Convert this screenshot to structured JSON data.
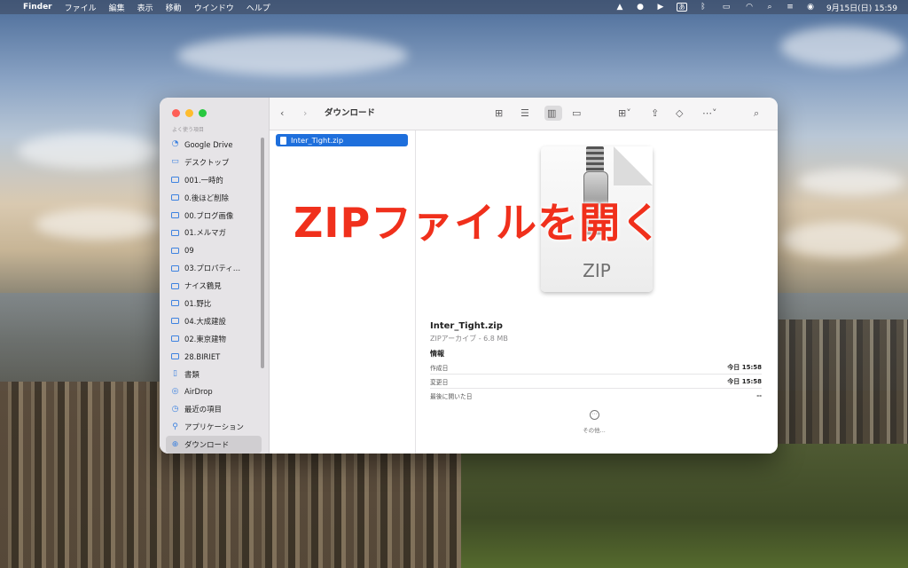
{
  "menubar": {
    "apple": "",
    "app_name": "Finder",
    "menus": [
      "ファイル",
      "編集",
      "表示",
      "移動",
      "ウインドウ",
      "ヘルプ"
    ],
    "input_method": "あ",
    "datetime": "9月15日(日)  15:59",
    "icons": [
      "drive-icon",
      "line-icon",
      "play-icon",
      "input-method-icon",
      "bluetooth-icon",
      "battery-icon",
      "wifi-icon",
      "search-icon",
      "control-center-icon",
      "siri-icon"
    ]
  },
  "finder": {
    "window_title": "ダウンロード",
    "sidebar_section": "よく使う項目",
    "sidebar_items": [
      {
        "label": "Google Drive",
        "icon": "google-drive-icon"
      },
      {
        "label": "デスクトップ",
        "icon": "desktop-icon"
      },
      {
        "label": "001.一時的",
        "icon": "folder-icon"
      },
      {
        "label": "0.後ほど削除",
        "icon": "folder-icon"
      },
      {
        "label": "00.ブログ画像",
        "icon": "folder-icon"
      },
      {
        "label": "01.メルマガ",
        "icon": "folder-icon"
      },
      {
        "label": "09",
        "icon": "folder-icon"
      },
      {
        "label": "03.プロパティ…",
        "icon": "folder-icon"
      },
      {
        "label": "ナイス鶴見",
        "icon": "folder-icon"
      },
      {
        "label": "01.野比",
        "icon": "folder-icon"
      },
      {
        "label": "04.大成建設",
        "icon": "folder-icon"
      },
      {
        "label": "02.東京建物",
        "icon": "folder-icon"
      },
      {
        "label": "28.BIRIET",
        "icon": "folder-icon"
      },
      {
        "label": "書類",
        "icon": "document-icon"
      },
      {
        "label": "AirDrop",
        "icon": "airdrop-icon"
      },
      {
        "label": "最近の項目",
        "icon": "clock-icon"
      },
      {
        "label": "アプリケーション",
        "icon": "applications-icon"
      },
      {
        "label": "ダウンロード",
        "icon": "download-icon",
        "active": true
      }
    ],
    "selected_file": "Inter_Tight.zip",
    "preview": {
      "icon_label": "ZIP",
      "name": "Inter_Tight.zip",
      "kind": "ZIPアーカイブ - 6.8 MB",
      "info_heading": "情報",
      "rows": [
        {
          "label": "作成日",
          "value": "今日 15:58"
        },
        {
          "label": "変更日",
          "value": "今日 15:58"
        },
        {
          "label": "最後に開いた日",
          "value": "--"
        }
      ],
      "more_label": "その他..."
    }
  },
  "overlay_caption": "ZIPファイルを開く",
  "colors": {
    "selection": "#1e6fdc",
    "overlay_text": "#f0301c",
    "folder_icon": "#3d82e0"
  }
}
